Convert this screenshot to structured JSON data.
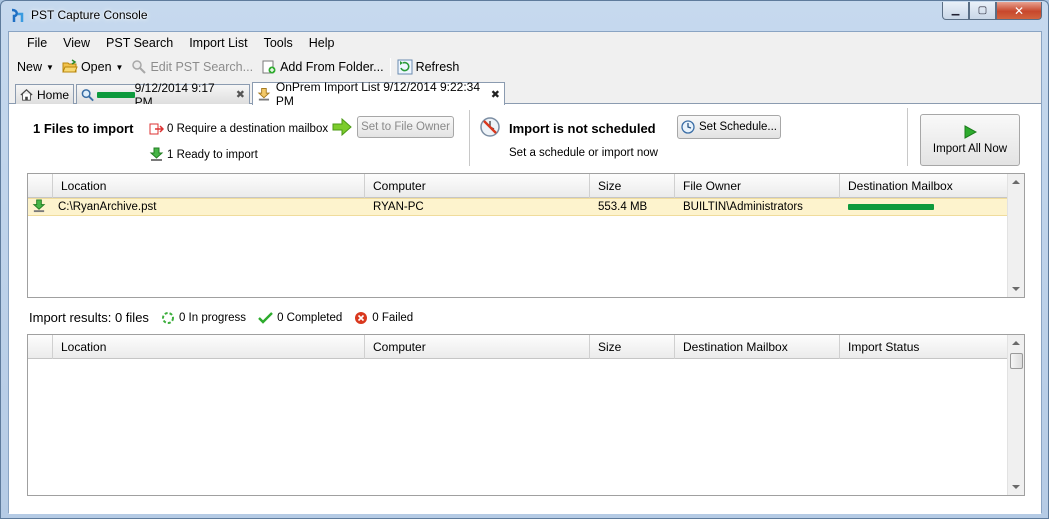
{
  "window": {
    "title": "PST Capture Console"
  },
  "menu": [
    "File",
    "View",
    "PST Search",
    "Import List",
    "Tools",
    "Help"
  ],
  "toolbar": {
    "new_label": "New",
    "open_label": "Open",
    "edit_search_label": "Edit PST Search...",
    "add_folder_label": "Add From Folder...",
    "refresh_label": "Refresh"
  },
  "tabs": {
    "home": "Home",
    "search_suffix": "9/12/2014 9:17 PM",
    "active": "OnPrem Import List 9/12/2014 9:22:34 PM"
  },
  "summary": {
    "files_to_import": "1 Files to import",
    "require_mailbox": "0 Require a destination mailbox",
    "ready": "1 Ready to import",
    "set_owner_button": "Set to File Owner",
    "schedule_title": "Import is not scheduled",
    "schedule_sub": "Set a schedule or import now",
    "set_schedule_button": "Set Schedule...",
    "import_all_button": "Import All Now"
  },
  "import_table": {
    "columns": [
      "Location",
      "Computer",
      "Size",
      "File Owner",
      "Destination Mailbox"
    ],
    "rows": [
      {
        "location": "C:\\RyanArchive.pst",
        "computer": "RYAN-PC",
        "size": "553.4 MB",
        "owner": "BUILTIN\\Administrators"
      }
    ]
  },
  "results": {
    "title": "Import results: 0 files",
    "in_progress": "0 In progress",
    "completed": "0 Completed",
    "failed": "0 Failed",
    "columns": [
      "Location",
      "Computer",
      "Size",
      "Destination Mailbox",
      "Import Status"
    ]
  },
  "colors": {
    "selected_row": "#fdf3cd",
    "redaction": "#0d9a3d",
    "accent_green": "#2dab2d",
    "fail_red": "#d9381e"
  }
}
